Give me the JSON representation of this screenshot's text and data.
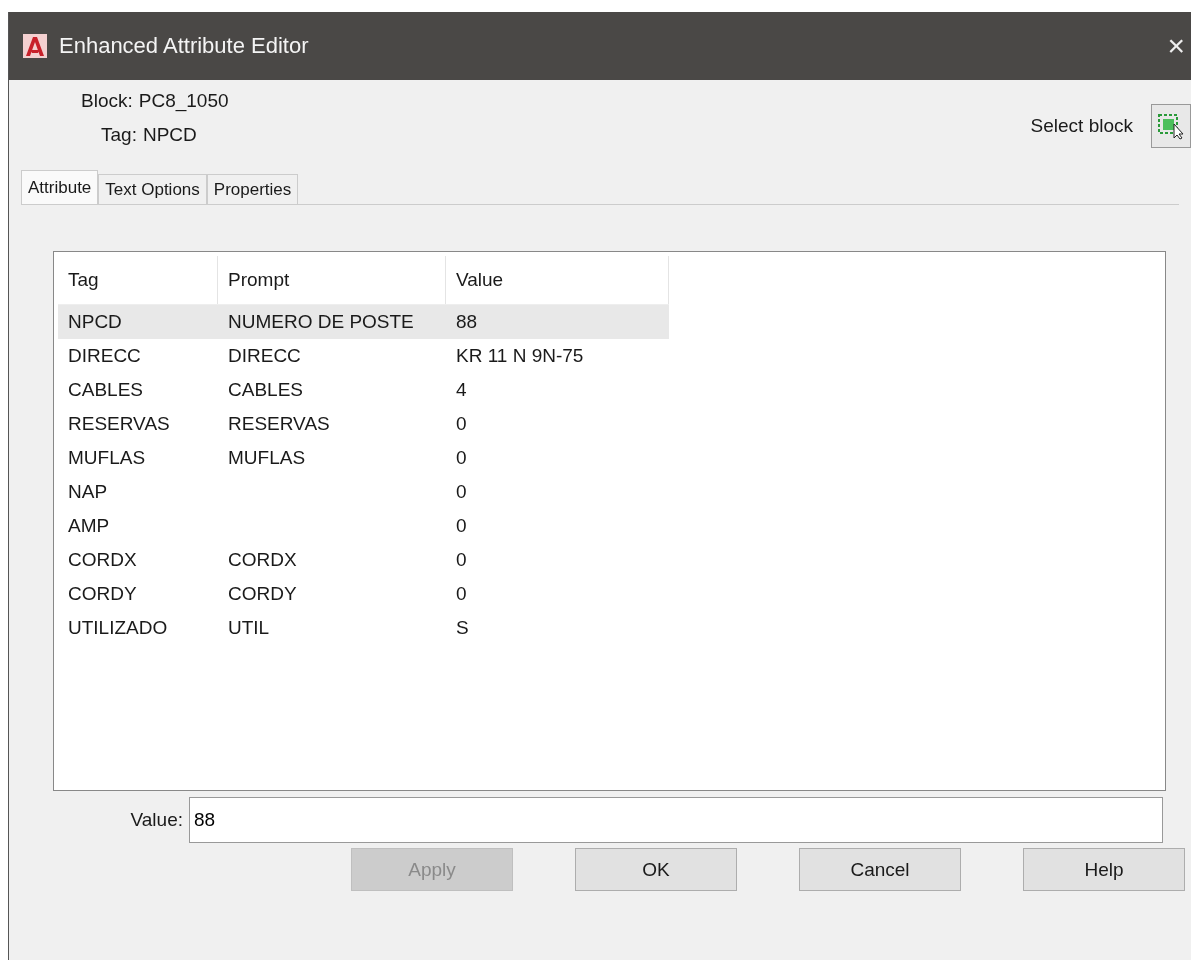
{
  "window": {
    "title": "Enhanced Attribute Editor",
    "close": "×"
  },
  "block": {
    "label": "Block:",
    "value": "PC8_1050"
  },
  "tag": {
    "label": "Tag:",
    "value": "NPCD"
  },
  "select_block": {
    "label": "Select block"
  },
  "tabs": [
    {
      "label": "Attribute",
      "selected": true
    },
    {
      "label": "Text Options",
      "selected": false
    },
    {
      "label": "Properties",
      "selected": false
    }
  ],
  "table": {
    "columns": [
      "Tag",
      "Prompt",
      "Value"
    ],
    "rows": [
      {
        "tag": "NPCD",
        "prompt": "NUMERO DE POSTE",
        "value": "88",
        "selected": true
      },
      {
        "tag": "DIRECC",
        "prompt": "DIRECC",
        "value": "KR 11 N 9N-75",
        "selected": false
      },
      {
        "tag": "CABLES",
        "prompt": "CABLES",
        "value": "4",
        "selected": false
      },
      {
        "tag": "RESERVAS",
        "prompt": "RESERVAS",
        "value": "0",
        "selected": false
      },
      {
        "tag": "MUFLAS",
        "prompt": "MUFLAS",
        "value": "0",
        "selected": false
      },
      {
        "tag": "NAP",
        "prompt": "",
        "value": "0",
        "selected": false
      },
      {
        "tag": "AMP",
        "prompt": "",
        "value": "0",
        "selected": false
      },
      {
        "tag": "CORDX",
        "prompt": "CORDX",
        "value": "0",
        "selected": false
      },
      {
        "tag": "CORDY",
        "prompt": "CORDY",
        "value": "0",
        "selected": false
      },
      {
        "tag": "UTILIZADO",
        "prompt": "UTIL",
        "value": "S",
        "selected": false
      }
    ]
  },
  "value_field": {
    "label": "Value:",
    "value": "88"
  },
  "buttons": [
    {
      "label": "Apply",
      "disabled": true
    },
    {
      "label": "OK",
      "disabled": false
    },
    {
      "label": "Cancel",
      "disabled": false
    },
    {
      "label": "Help",
      "disabled": false
    }
  ]
}
